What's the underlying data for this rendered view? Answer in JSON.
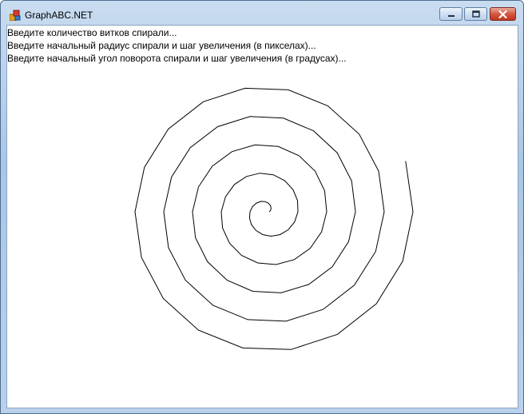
{
  "window": {
    "title": "GraphABC.NET",
    "buttons": [
      "minimize",
      "maximize",
      "close"
    ]
  },
  "console": {
    "lines": [
      "Введите количество витков спирали...",
      "Введите начальный радиус спирали и шаг увеличения (в пикселах)...",
      "Введите начальный угол поворота спирали и шаг увеличения (в градусах)..."
    ]
  },
  "icons": {
    "app": "graphabc-app-icon",
    "minimize": "minimize-icon",
    "maximize": "maximize-icon",
    "close": "close-icon"
  },
  "colors": {
    "spiral": "#000000",
    "close_button": "#c1351c"
  }
}
